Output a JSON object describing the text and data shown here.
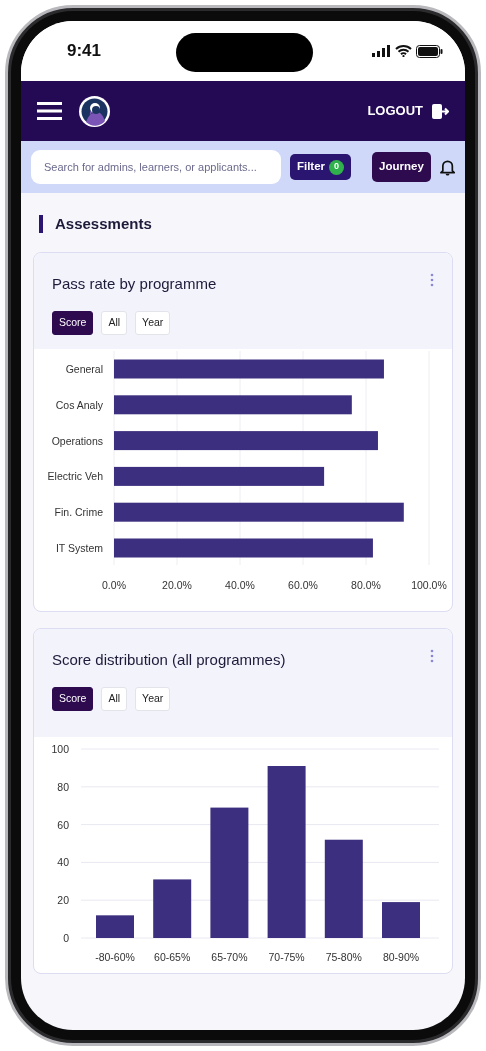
{
  "status_bar": {
    "time": "9:41"
  },
  "header": {
    "logout": "LOGOUT"
  },
  "search": {
    "placeholder": "Search for admins, learners, or applicants..."
  },
  "toolbar": {
    "filter": {
      "label": "Filter",
      "count": "0"
    },
    "journey": "Journey"
  },
  "section_title": "Assessments",
  "cards": [
    {
      "title": "Pass rate by programme",
      "toggles": [
        {
          "label": "Score",
          "selected": true
        },
        {
          "label": "All",
          "selected": false
        },
        {
          "label": "Year",
          "selected": false
        }
      ],
      "chart_data": {
        "type": "bar",
        "orientation": "horizontal",
        "categories": [
          "General",
          "Cos Analy",
          "Operations",
          "Electric Veh",
          "Fin. Crime",
          "IT System"
        ],
        "values": [
          85.7,
          75.5,
          83.8,
          66.7,
          92,
          82.2
        ],
        "grid": true,
        "xlim": [
          0,
          100
        ],
        "xticks": [
          {
            "value": 0,
            "label": "0.0%"
          },
          {
            "value": 20,
            "label": "20.0%"
          },
          {
            "value": 40,
            "label": "40.0%"
          },
          {
            "value": 60,
            "label": "60.0%"
          },
          {
            "value": 80,
            "label": "80.0%"
          },
          {
            "value": 100,
            "label": "100.0%"
          }
        ]
      }
    },
    {
      "title": "Score distribution (all programmes)",
      "toggles": [
        {
          "label": "Score",
          "selected": true
        },
        {
          "label": "All",
          "selected": false
        },
        {
          "label": "Year",
          "selected": false
        }
      ],
      "chart_data": {
        "type": "bar",
        "orientation": "vertical",
        "categories": [
          "-80-60%",
          "60-65%",
          "65-70%",
          "70-75%",
          "75-80%",
          "80-90%"
        ],
        "values": [
          12,
          31,
          69,
          91,
          52,
          19
        ],
        "grid": true,
        "ylim": [
          0,
          100
        ],
        "yticks": [
          0,
          20,
          40,
          60,
          80,
          100
        ]
      }
    }
  ]
}
